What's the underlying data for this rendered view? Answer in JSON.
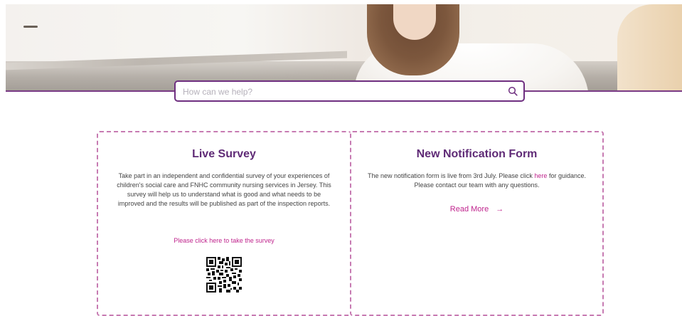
{
  "search": {
    "placeholder": "How can we help?"
  },
  "cards": [
    {
      "title": "Live Survey",
      "body": "Take part in an independent and confidential survey of your experiences of children's social care and FNHC community nursing services in Jersey. This survey will help us to understand what is good and what needs to be improved and the results will be published as part of the inspection reports.",
      "link": "Please click here to take the survey"
    },
    {
      "title": "New Notification Form",
      "body_before": "The new notification form is live from 3rd July. Please click ",
      "body_link": "here",
      "body_after": " for guidance. Please contact our team with any questions.",
      "read_more": "Read More",
      "arrow": "→"
    }
  ],
  "colors": {
    "brand": "#6f2f80",
    "link": "#c0268e",
    "card_border": "#c77bb2"
  },
  "icons": {
    "search": "search-icon",
    "arrow": "arrow-right-icon",
    "qr": "qr-code"
  }
}
